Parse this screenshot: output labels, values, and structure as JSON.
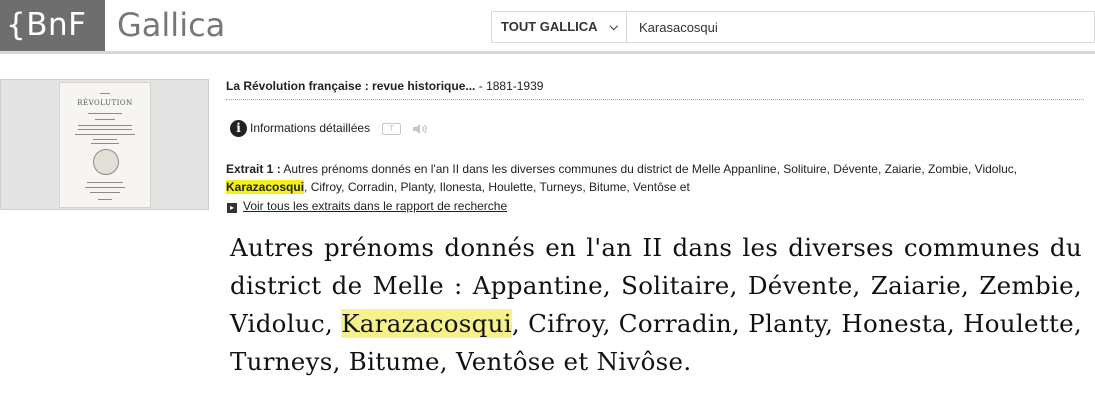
{
  "header": {
    "bnf_logo": "{BnF",
    "gallica_logo": "Gallica",
    "search_scope": "TOUT GALLICA",
    "search_value": "Karasacosqui"
  },
  "record": {
    "thumbnail_title": "RÉVOLUTION",
    "title": "La Révolution française : revue historique...",
    "dates": " - 1881-1939",
    "info_label": "Informations détaillées",
    "text_icon_label": "T"
  },
  "extract": {
    "label": "Extrait 1 :",
    "before": " Autres prénoms donnés en l'an II dans les diverses communes du district de Melle Appanline, Solituire, Dévente, Zaiarie, Zombie, Vidoluc, ",
    "highlight": "Karazacosqui",
    "after": ", Cifroy, Corradin, Planty, Ilonesta, Houlette, Turneys, Bitume, Ventôse et",
    "see_all": "Voir tous les extraits dans le rapport de recherche"
  },
  "scan": {
    "before": "Autres prénoms donnés en l'an II dans les diverses communes du district de Melle : Appantine, Solitaire, Dévente, Zaiarie, Zembie, Vidoluc, ",
    "highlight": "Karazacosqui",
    "after": ", Cifroy, Corradin, Planty, Honesta, Houlette, Turneys, Bitume, Ventôse et Nivôse."
  }
}
